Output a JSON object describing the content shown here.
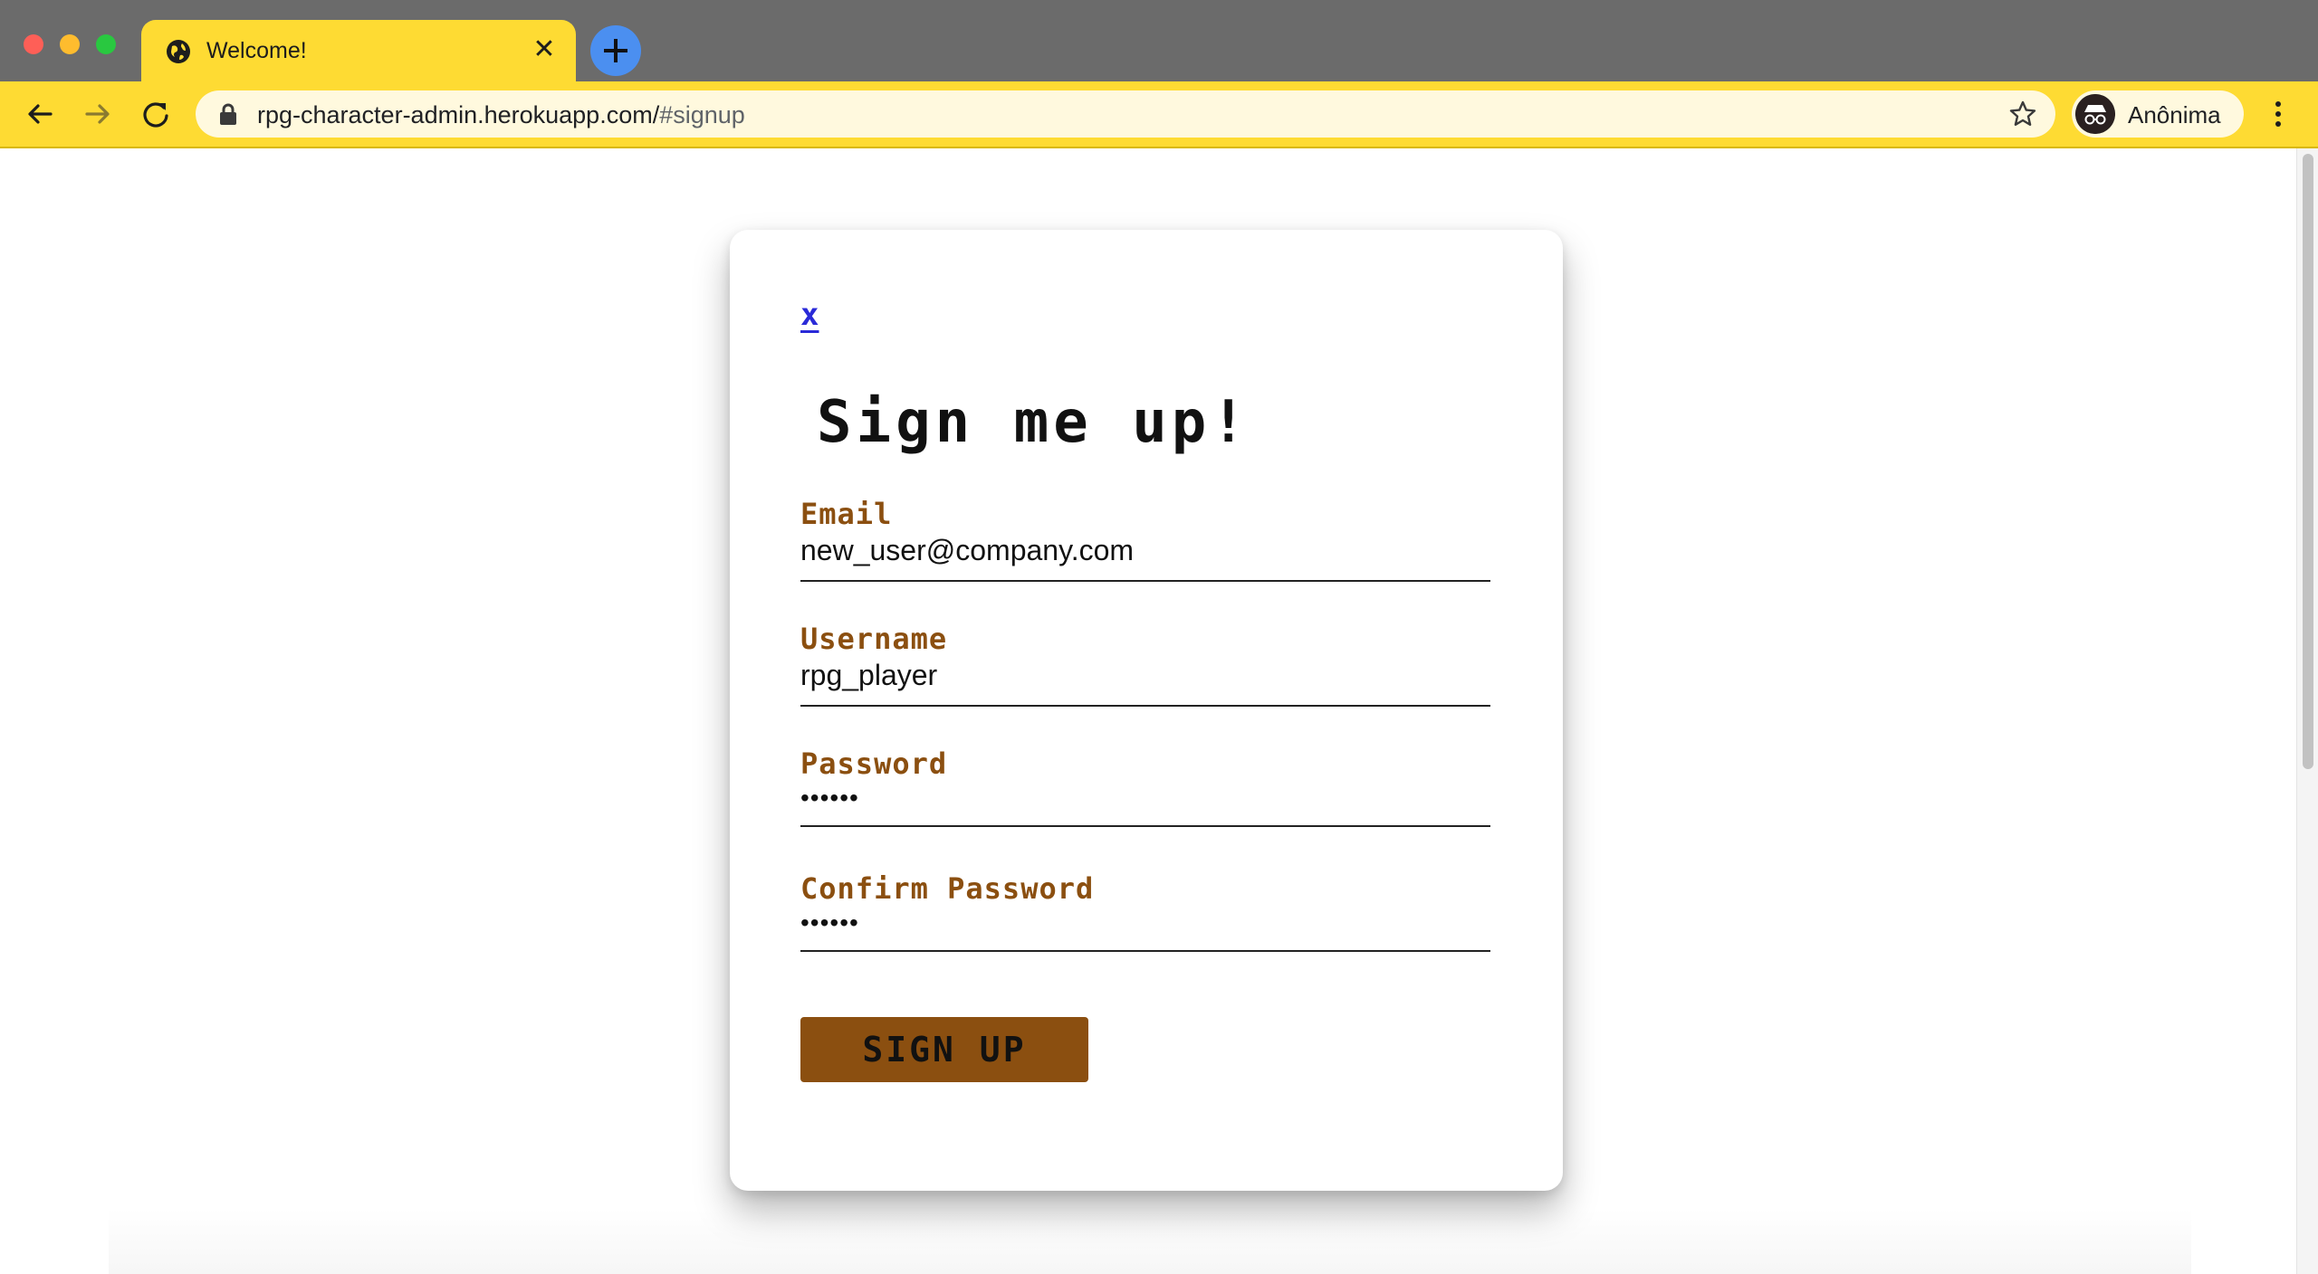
{
  "browser": {
    "tab_title": "Welcome!",
    "tab_close": "✕",
    "url_host": "rpg-character-admin.herokuapp.com/",
    "url_path": "#signup",
    "profile_name": "Anônima",
    "accent_color": "#fedb33"
  },
  "form": {
    "close_label": "x",
    "title": "Sign me up!",
    "email_label": "Email",
    "email_value": "new_user@company.com",
    "username_label": "Username",
    "username_value": "rpg_player",
    "password_label": "Password",
    "password_value": "••••••",
    "confirm_label": "Confirm Password",
    "confirm_value": "••••••",
    "submit_label": "SIGN UP",
    "label_color": "#8b4f10",
    "button_color": "#8b4f10"
  }
}
